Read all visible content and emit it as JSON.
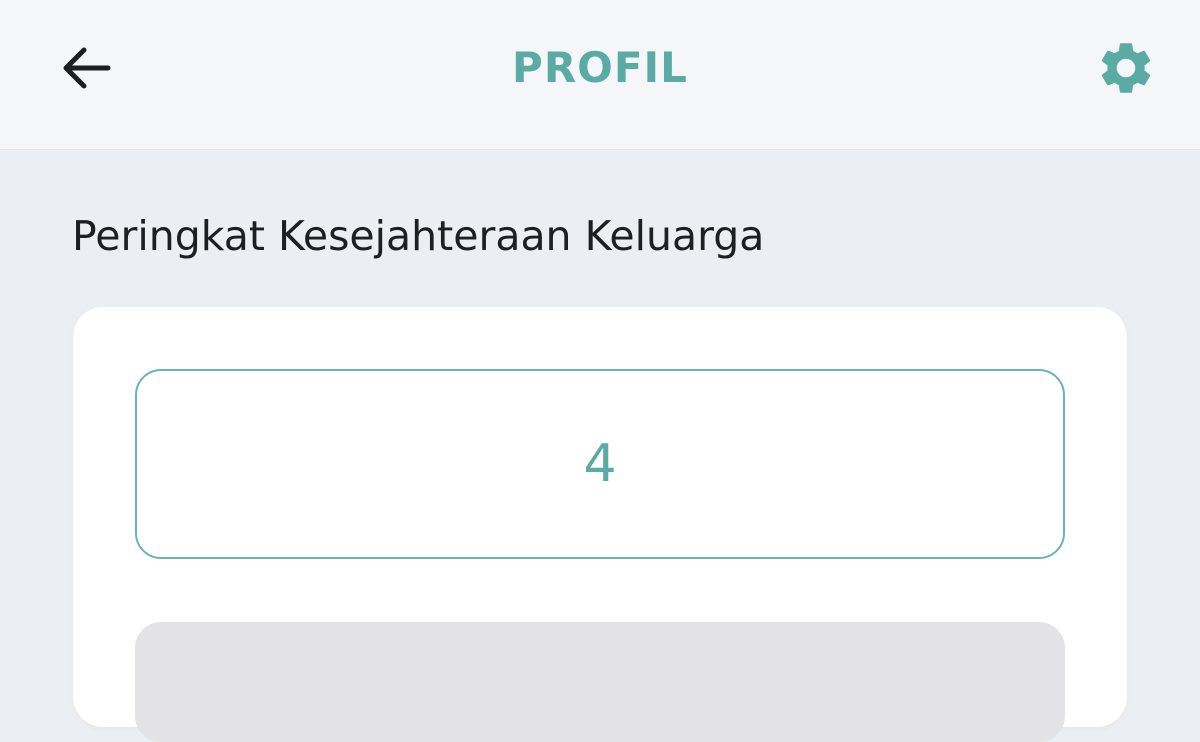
{
  "app_bar": {
    "title": "PROFIL",
    "back_icon": "arrow-left-icon",
    "settings_icon": "gear-icon"
  },
  "section": {
    "title": "Peringkat Kesejahteraan Keluarga"
  },
  "rank": {
    "value": "4"
  },
  "colors": {
    "accent": "#5aaba3",
    "border": "#6bb5ad",
    "background": "#ebeef2",
    "app_bar_background": "#f5f6fa",
    "text": "#1e1f22",
    "placeholder": "#e3e3e5"
  }
}
